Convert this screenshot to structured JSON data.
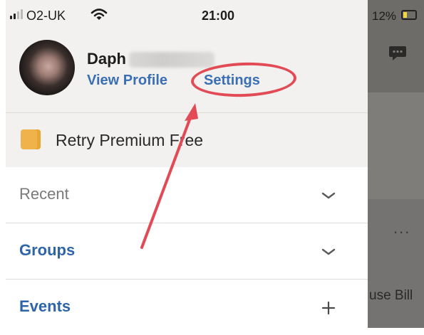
{
  "status_bar": {
    "carrier": "O2-UK",
    "time": "21:00",
    "battery": "12%",
    "icons": [
      "signal-icon",
      "wifi-icon",
      "battery-icon"
    ]
  },
  "profile": {
    "name": "Daph",
    "view_profile": "View Profile",
    "settings": "Settings"
  },
  "premium": {
    "label": "Retry Premium Free",
    "icon": "premium-icon"
  },
  "menu": [
    {
      "label": "Recent",
      "icon": "chevron-down-icon",
      "style": "gray"
    },
    {
      "label": "Groups",
      "icon": "chevron-down-icon",
      "style": "blue"
    },
    {
      "label": "Events",
      "icon": "plus-icon",
      "style": "blue"
    }
  ],
  "background_app": {
    "more": "...",
    "bill_text": "use Bill"
  },
  "colors": {
    "link_blue": "#3a6fb4",
    "annotation_red": "#e24a55",
    "premium_orange": "#f0b24a"
  }
}
